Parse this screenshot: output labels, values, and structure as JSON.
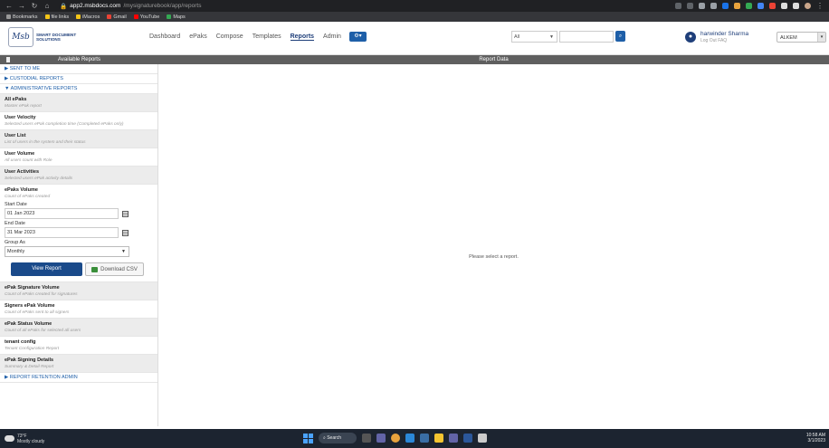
{
  "browser": {
    "url_domain": "app2.msbdocs.com",
    "url_path": "/mysignaturebook/app/reports",
    "bookmarks": [
      {
        "label": "Bookmarks",
        "color": "#999999"
      },
      {
        "label": "file links",
        "color": "#f5c518"
      },
      {
        "label": "iMacros",
        "color": "#f5c518"
      },
      {
        "label": "Gmail",
        "color": "#ea4335"
      },
      {
        "label": "YouTube",
        "color": "#ff0000"
      },
      {
        "label": "Maps",
        "color": "#34a853"
      }
    ]
  },
  "header": {
    "logo_mark": "Msb",
    "logo_line1": "SMART DOCUMENT",
    "logo_line2": "SOLUTIONS",
    "nav": [
      "Dashboard",
      "ePaks",
      "Compose",
      "Templates",
      "Reports",
      "Admin"
    ],
    "active_nav": "Reports",
    "search_filter": "All",
    "search_placeholder": "",
    "user_name": "harwinder Sharma",
    "logout": "Log Out",
    "faq": "FAQ",
    "tenant": "ALKEM"
  },
  "panel_heads": {
    "left": "Available Reports",
    "right": "Report Data"
  },
  "sidebar": {
    "sections": {
      "sent": "▶ SENT TO ME",
      "custodial": "▶ CUSTODIAL REPORTS",
      "admin": "▼ ADMINISTRATIVE REPORTS",
      "retention": "▶ REPORT RETENTION ADMIN"
    },
    "reports": [
      {
        "title": "All ePaks",
        "desc": "Master ePak report"
      },
      {
        "title": "User Velocity",
        "desc": "Selected users ePak completion time (Completed ePaks only)"
      },
      {
        "title": "User List",
        "desc": "List of users in the system and their status"
      },
      {
        "title": "User Volume",
        "desc": "All users count with Role"
      },
      {
        "title": "User Activities",
        "desc": "Selected users ePak activity details"
      },
      {
        "title": "ePaks Volume",
        "desc": "Count of ePaks created"
      },
      {
        "title": "ePak Signature Volume",
        "desc": "Count of ePaks created for signatures"
      },
      {
        "title": "Signers ePak Volume",
        "desc": "Count of ePaks sent to all signers"
      },
      {
        "title": "ePak Status Volume",
        "desc": "Count of all ePaks for selected all users"
      },
      {
        "title": "tenant config",
        "desc": "Tenant Configuration Report"
      },
      {
        "title": "ePak Signing Details",
        "desc": "Summary & Detail Report"
      }
    ],
    "form": {
      "start_label": "Start Date",
      "start_value": "01 Jan 2023",
      "end_label": "End Date",
      "end_value": "31 Mar 2023",
      "group_label": "Group As",
      "group_value": "Monthly",
      "view_button": "View Report",
      "csv_button": "Download CSV"
    }
  },
  "main": {
    "empty_message": "Please select a report."
  },
  "taskbar": {
    "temp": "73°F",
    "weather": "Mostly cloudy",
    "search": "Search",
    "time": "10:58 AM",
    "date": "3/1/2023"
  }
}
